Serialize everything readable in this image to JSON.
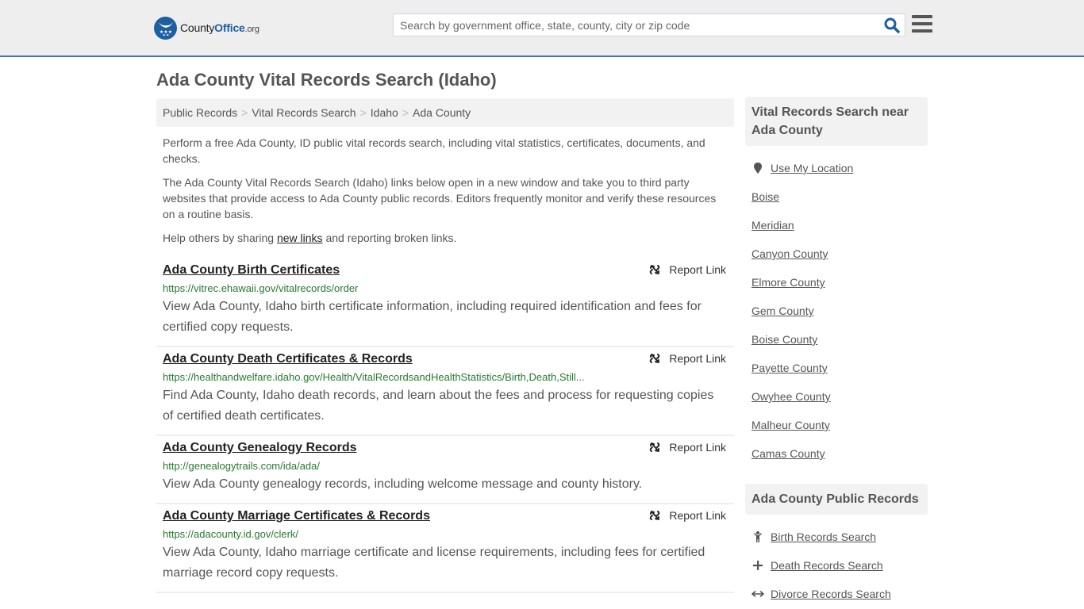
{
  "header": {
    "logo": {
      "county": "County",
      "office": "Office",
      "org": ".org"
    },
    "search": {
      "placeholder": "Search by government office, state, county, city or zip code",
      "value": ""
    },
    "search_icon": "search-icon",
    "menu_icon": "hamburger-menu-icon"
  },
  "page": {
    "title": "Ada County Vital Records Search (Idaho)"
  },
  "breadcrumb": [
    {
      "label": "Public Records"
    },
    {
      "label": "Vital Records Search"
    },
    {
      "label": "Idaho"
    },
    {
      "label": "Ada County"
    }
  ],
  "breadcrumb_separator": ">",
  "intro": {
    "p1": "Perform a free Ada County, ID public vital records search, including vital statistics, certificates, documents, and checks.",
    "p2": "The Ada County Vital Records Search (Idaho) links below open in a new window and take you to third party websites that provide access to Ada County public records. Editors frequently monitor and verify these resources on a routine basis.",
    "p3_before": "Help others by sharing ",
    "p3_link": "new links",
    "p3_after": " and reporting broken links."
  },
  "results": [
    {
      "title": "Ada County Birth Certificates",
      "url": "https://vitrec.ehawaii.gov/vitalrecords/order",
      "description": "View Ada County, Idaho birth certificate information, including required identification and fees for certified copy requests.",
      "report_label": "Report Link"
    },
    {
      "title": "Ada County Death Certificates & Records",
      "url": "https://healthandwelfare.idaho.gov/Health/VitalRecordsandHealthStatistics/Birth,Death,Still...",
      "description": "Find Ada County, Idaho death records, and learn about the fees and process for requesting copies of certified death certificates.",
      "report_label": "Report Link"
    },
    {
      "title": "Ada County Genealogy Records",
      "url": "http://genealogytrails.com/ida/ada/",
      "description": "View Ada County genealogy records, including welcome message and county history.",
      "report_label": "Report Link"
    },
    {
      "title": "Ada County Marriage Certificates & Records",
      "url": "https://adacounty.id.gov/clerk/",
      "description": "View Ada County, Idaho marriage certificate and license requirements, including fees for certified marriage record copy requests.",
      "report_label": "Report Link"
    }
  ],
  "sidebar": {
    "nearby": {
      "heading": "Vital Records Search near Ada County",
      "use_location": "Use My Location",
      "items": [
        "Boise",
        "Meridian",
        "Canyon County",
        "Elmore County",
        "Gem County",
        "Boise County",
        "Payette County",
        "Owyhee County",
        "Malheur County",
        "Camas County"
      ]
    },
    "public_records": {
      "heading": "Ada County Public Records",
      "items": [
        {
          "label": "Birth Records Search",
          "icon": "child-icon"
        },
        {
          "label": "Death Records Search",
          "icon": "cross-icon"
        },
        {
          "label": "Divorce Records Search",
          "icon": "arrows-horizontal-icon"
        }
      ]
    }
  },
  "colors": {
    "brand_blue": "#1d5fa0",
    "header_border": "#3b7aab",
    "url_green": "#287a2e",
    "text": "#555555"
  }
}
